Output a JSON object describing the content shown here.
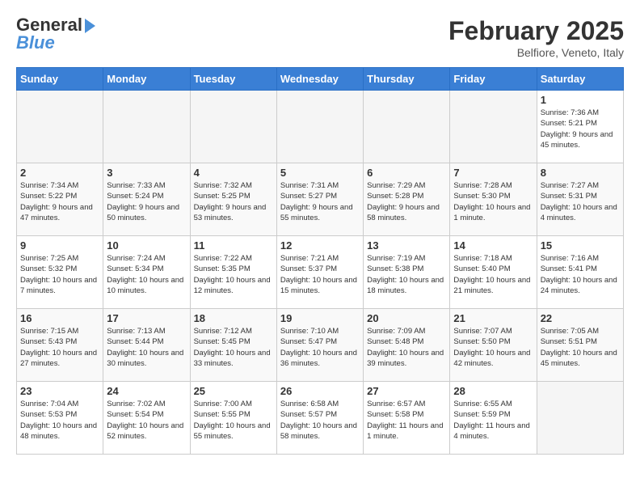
{
  "logo": {
    "text_general": "General",
    "text_blue": "Blue"
  },
  "header": {
    "title": "February 2025",
    "subtitle": "Belfiore, Veneto, Italy"
  },
  "days_of_week": [
    "Sunday",
    "Monday",
    "Tuesday",
    "Wednesday",
    "Thursday",
    "Friday",
    "Saturday"
  ],
  "weeks": [
    [
      {
        "day": "",
        "info": ""
      },
      {
        "day": "",
        "info": ""
      },
      {
        "day": "",
        "info": ""
      },
      {
        "day": "",
        "info": ""
      },
      {
        "day": "",
        "info": ""
      },
      {
        "day": "",
        "info": ""
      },
      {
        "day": "1",
        "info": "Sunrise: 7:36 AM\nSunset: 5:21 PM\nDaylight: 9 hours and 45 minutes."
      }
    ],
    [
      {
        "day": "2",
        "info": "Sunrise: 7:34 AM\nSunset: 5:22 PM\nDaylight: 9 hours and 47 minutes."
      },
      {
        "day": "3",
        "info": "Sunrise: 7:33 AM\nSunset: 5:24 PM\nDaylight: 9 hours and 50 minutes."
      },
      {
        "day": "4",
        "info": "Sunrise: 7:32 AM\nSunset: 5:25 PM\nDaylight: 9 hours and 53 minutes."
      },
      {
        "day": "5",
        "info": "Sunrise: 7:31 AM\nSunset: 5:27 PM\nDaylight: 9 hours and 55 minutes."
      },
      {
        "day": "6",
        "info": "Sunrise: 7:29 AM\nSunset: 5:28 PM\nDaylight: 9 hours and 58 minutes."
      },
      {
        "day": "7",
        "info": "Sunrise: 7:28 AM\nSunset: 5:30 PM\nDaylight: 10 hours and 1 minute."
      },
      {
        "day": "8",
        "info": "Sunrise: 7:27 AM\nSunset: 5:31 PM\nDaylight: 10 hours and 4 minutes."
      }
    ],
    [
      {
        "day": "9",
        "info": "Sunrise: 7:25 AM\nSunset: 5:32 PM\nDaylight: 10 hours and 7 minutes."
      },
      {
        "day": "10",
        "info": "Sunrise: 7:24 AM\nSunset: 5:34 PM\nDaylight: 10 hours and 10 minutes."
      },
      {
        "day": "11",
        "info": "Sunrise: 7:22 AM\nSunset: 5:35 PM\nDaylight: 10 hours and 12 minutes."
      },
      {
        "day": "12",
        "info": "Sunrise: 7:21 AM\nSunset: 5:37 PM\nDaylight: 10 hours and 15 minutes."
      },
      {
        "day": "13",
        "info": "Sunrise: 7:19 AM\nSunset: 5:38 PM\nDaylight: 10 hours and 18 minutes."
      },
      {
        "day": "14",
        "info": "Sunrise: 7:18 AM\nSunset: 5:40 PM\nDaylight: 10 hours and 21 minutes."
      },
      {
        "day": "15",
        "info": "Sunrise: 7:16 AM\nSunset: 5:41 PM\nDaylight: 10 hours and 24 minutes."
      }
    ],
    [
      {
        "day": "16",
        "info": "Sunrise: 7:15 AM\nSunset: 5:43 PM\nDaylight: 10 hours and 27 minutes."
      },
      {
        "day": "17",
        "info": "Sunrise: 7:13 AM\nSunset: 5:44 PM\nDaylight: 10 hours and 30 minutes."
      },
      {
        "day": "18",
        "info": "Sunrise: 7:12 AM\nSunset: 5:45 PM\nDaylight: 10 hours and 33 minutes."
      },
      {
        "day": "19",
        "info": "Sunrise: 7:10 AM\nSunset: 5:47 PM\nDaylight: 10 hours and 36 minutes."
      },
      {
        "day": "20",
        "info": "Sunrise: 7:09 AM\nSunset: 5:48 PM\nDaylight: 10 hours and 39 minutes."
      },
      {
        "day": "21",
        "info": "Sunrise: 7:07 AM\nSunset: 5:50 PM\nDaylight: 10 hours and 42 minutes."
      },
      {
        "day": "22",
        "info": "Sunrise: 7:05 AM\nSunset: 5:51 PM\nDaylight: 10 hours and 45 minutes."
      }
    ],
    [
      {
        "day": "23",
        "info": "Sunrise: 7:04 AM\nSunset: 5:53 PM\nDaylight: 10 hours and 48 minutes."
      },
      {
        "day": "24",
        "info": "Sunrise: 7:02 AM\nSunset: 5:54 PM\nDaylight: 10 hours and 52 minutes."
      },
      {
        "day": "25",
        "info": "Sunrise: 7:00 AM\nSunset: 5:55 PM\nDaylight: 10 hours and 55 minutes."
      },
      {
        "day": "26",
        "info": "Sunrise: 6:58 AM\nSunset: 5:57 PM\nDaylight: 10 hours and 58 minutes."
      },
      {
        "day": "27",
        "info": "Sunrise: 6:57 AM\nSunset: 5:58 PM\nDaylight: 11 hours and 1 minute."
      },
      {
        "day": "28",
        "info": "Sunrise: 6:55 AM\nSunset: 5:59 PM\nDaylight: 11 hours and 4 minutes."
      },
      {
        "day": "",
        "info": ""
      }
    ]
  ]
}
